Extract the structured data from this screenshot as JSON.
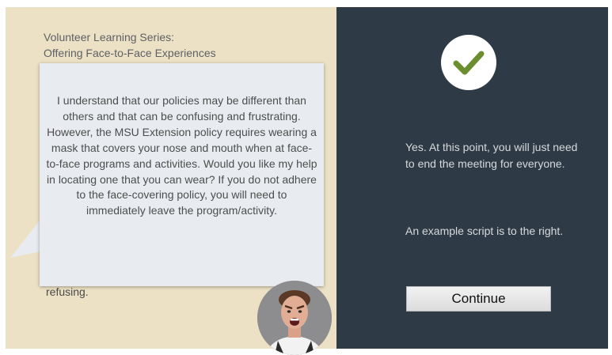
{
  "course": {
    "title_line1": "Volunteer Learning Series:",
    "title_line2": "Offering Face-to-Face Experiences"
  },
  "speech_bubble": {
    "text": "I understand that our policies may be different than others and that can be confusing and frustrating.  However, the MSU Extension policy requires wearing a mask that covers your nose and mouth when at face-to-face programs and activities.  Would you like my help in locating one that you can wear?  If you do not adhere to the face-covering policy, you will need to immediately leave the program/activity."
  },
  "partially_hidden_text": "refusing.",
  "feedback": {
    "paragraph1": "Yes. At this point, you will just need to end the meeting for everyone.",
    "paragraph2": "An example script is to the right."
  },
  "continue_button": {
    "label": "Continue"
  },
  "colors": {
    "left_panel": "#ece1c4",
    "right_panel": "#2e3a45",
    "checkmark": "#6b8f2e",
    "bubble": "#e8ecf0"
  },
  "icons": {
    "status": "checkmark-icon",
    "character": "angry-man-avatar"
  }
}
